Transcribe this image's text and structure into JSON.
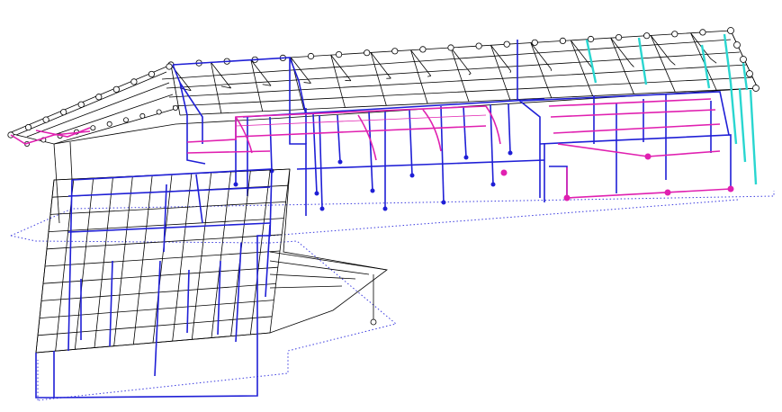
{
  "view": {
    "background": "#ffffff",
    "projection": "isometric-wireframe"
  },
  "colors": {
    "roof_mesh": "#000000",
    "steel_frame": "#1f1fd6",
    "braces": "#e020b0",
    "columns_secondary": "#2ad6d0",
    "ground_outline": "#3a3adf"
  },
  "layers": [
    {
      "name": "roof-truss-mesh",
      "color_key": "roof_mesh"
    },
    {
      "name": "steel-frame",
      "color_key": "steel_frame"
    },
    {
      "name": "bracing",
      "color_key": "braces"
    },
    {
      "name": "secondary-columns",
      "color_key": "columns_secondary"
    },
    {
      "name": "ground-outline",
      "color_key": "ground_outline"
    }
  ]
}
